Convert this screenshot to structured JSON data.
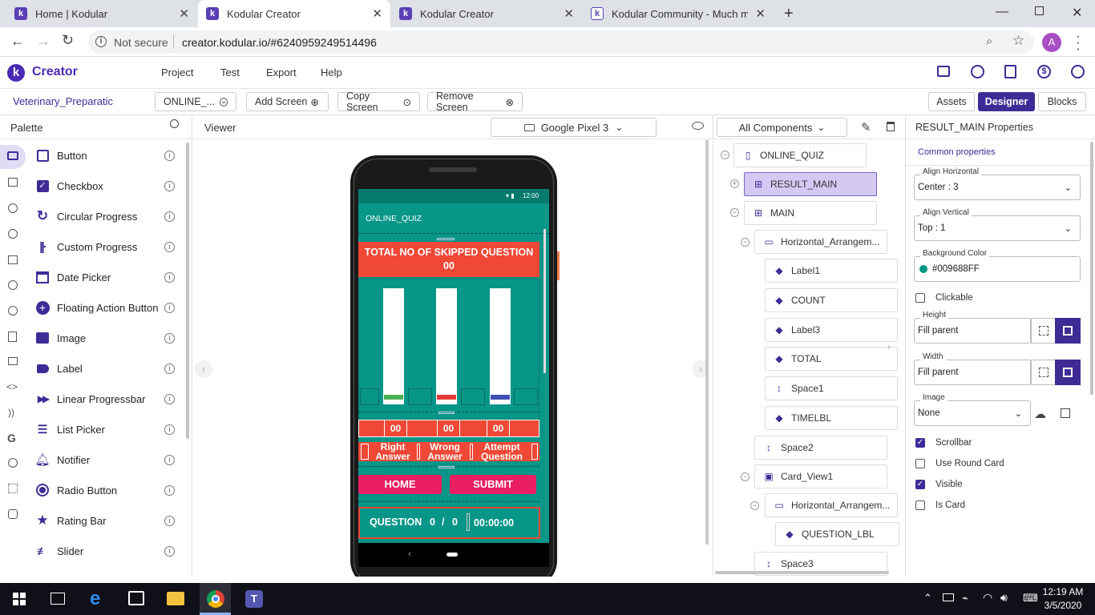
{
  "browser": {
    "tabs": [
      {
        "title": "Home | Kodular"
      },
      {
        "title": "Kodular Creator"
      },
      {
        "title": "Kodular Creator"
      },
      {
        "title": "Kodular Community - Much more"
      }
    ],
    "security": "Not secure",
    "url": "creator.kodular.io/#6240959249514496",
    "profile_initial": "A"
  },
  "app": {
    "logo": "Creator",
    "menu": [
      "Project",
      "Test",
      "Export",
      "Help"
    ],
    "project_name": "Veterinary_Preparatic",
    "screen_select": "ONLINE_...",
    "add_screen": "Add Screen",
    "copy_screen": "Copy Screen",
    "remove_screen": "Remove Screen",
    "modes": [
      "Assets",
      "Designer",
      "Blocks"
    ]
  },
  "palette": {
    "title": "Palette",
    "items": [
      "Button",
      "Checkbox",
      "Circular Progress",
      "Custom Progress",
      "Date Picker",
      "Floating Action Button",
      "Image",
      "Label",
      "Linear Progressbar",
      "List Picker",
      "Notifier",
      "Radio Button",
      "Rating Bar",
      "Slider"
    ]
  },
  "viewer": {
    "title": "Viewer",
    "device": "Google Pixel 3",
    "phone": {
      "time": "12:00",
      "app_title": "ONLINE_QUIZ",
      "skipped_label": "TOTAL NO OF SKIPPED QUESTION",
      "skipped_count": "00",
      "bars": [
        {
          "color": "#4caf50"
        },
        {
          "color": "#e53935"
        },
        {
          "color": "#3f51b5"
        }
      ],
      "counts": [
        "00",
        "00",
        "00"
      ],
      "right_label_1": "Right",
      "right_label_2": "Answer",
      "wrong_label_1": "Wrong",
      "wrong_label_2": "Answer",
      "attempt_label_1": "Attempt",
      "attempt_label_2": "Question",
      "home": "HOME",
      "submit": "SUBMIT",
      "question_label": "QUESTION",
      "question_current": "0",
      "question_sep": "/",
      "question_total": "0",
      "timer": "00:00:00"
    }
  },
  "tree": {
    "filter": "All Components",
    "nodes": [
      "ONLINE_QUIZ",
      "RESULT_MAIN",
      "MAIN",
      "Horizontal_Arrangem...",
      "Label1",
      "COUNT",
      "Label3",
      "TOTAL",
      "Space1",
      "TIMELBL",
      "Space2",
      "Card_View1",
      "Horizontal_Arrangem...",
      "QUESTION_LBL",
      "Space3"
    ]
  },
  "props": {
    "title": "RESULT_MAIN Properties",
    "section": "Common properties",
    "align_h_label": "Align Horizontal",
    "align_h": "Center : 3",
    "align_v_label": "Align Vertical",
    "align_v": "Top : 1",
    "bg_label": "Background Color",
    "bg": "#009688FF",
    "clickable": "Clickable",
    "height_label": "Height",
    "height": "Fill parent",
    "width_label": "Width",
    "width": "Fill parent",
    "image_label": "Image",
    "image": "None",
    "scrollbar": "Scrollbar",
    "use_round_card": "Use Round Card",
    "visible": "Visible",
    "is_card": "Is Card"
  },
  "taskbar": {
    "time": "12:19 AM",
    "date": "3/5/2020"
  },
  "colors": {
    "accent": "#3f2b96",
    "teal": "#079688",
    "red": "#ef4836",
    "pink": "#e91e63"
  }
}
